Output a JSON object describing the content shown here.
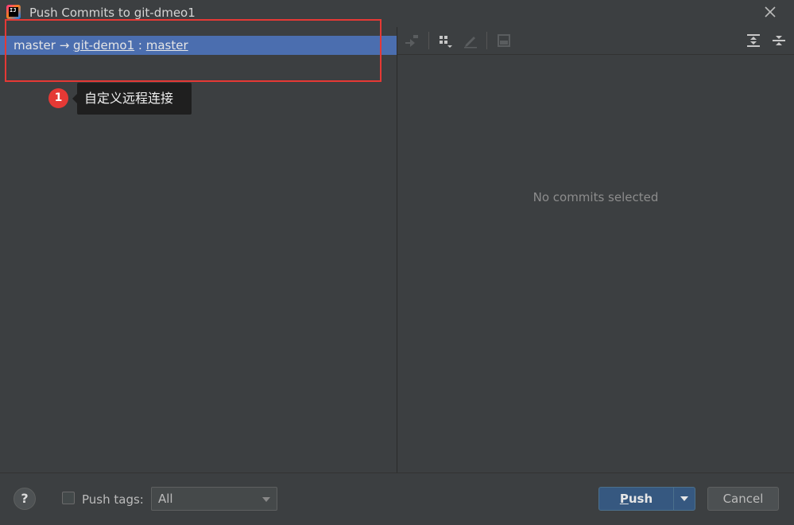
{
  "window": {
    "title": "Push Commits to git-dmeo1",
    "app_icon_text": "IJ"
  },
  "left_pane": {
    "branch_row": {
      "local_branch": "master",
      "arrow": "→",
      "remote": "git-demo1",
      "separator": ":",
      "remote_branch": "master"
    },
    "annotation": {
      "badge_number": "1",
      "callout_text": "自定义远程连接"
    }
  },
  "right_pane": {
    "empty_message": "No commits selected",
    "toolbar_icons": [
      "cherry-pick-icon",
      "group-by-icon",
      "edit-icon",
      "diff-icon",
      "expand-all-icon",
      "collapse-all-icon"
    ]
  },
  "bottom_bar": {
    "help_label": "?",
    "push_tags_label": "Push tags:",
    "push_tags_checked": false,
    "tags_select_value": "All",
    "push_button_mnemonic": "P",
    "push_button_rest": "ush",
    "cancel_button": "Cancel"
  },
  "colors": {
    "background": "#3c3f41",
    "selection": "#4b6eaf",
    "highlight_border": "#e53935",
    "primary_button": "#365880"
  }
}
